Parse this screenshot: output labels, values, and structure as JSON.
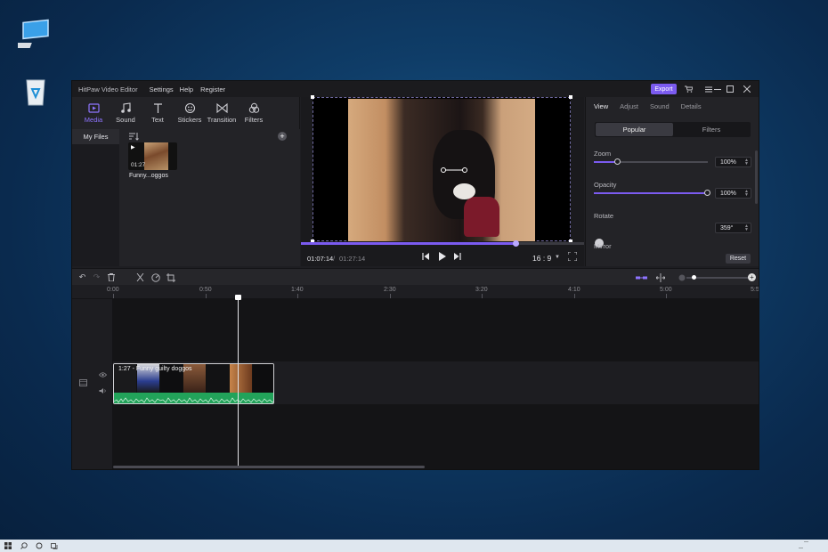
{
  "window": {
    "app_title": "HitPaw Video Editor",
    "menu": [
      "Settings",
      "Help",
      "Register"
    ],
    "export_label": "Export"
  },
  "tools": [
    {
      "label": "Media",
      "icon": "media-icon",
      "active": true
    },
    {
      "label": "Sound",
      "icon": "music-note-icon",
      "active": false
    },
    {
      "label": "Text",
      "icon": "text-icon",
      "active": false
    },
    {
      "label": "Stickers",
      "icon": "smiley-icon",
      "active": false
    },
    {
      "label": "Transition",
      "icon": "bowtie-icon",
      "active": false
    },
    {
      "label": "Filters",
      "icon": "circles-icon",
      "active": false
    }
  ],
  "sidebar": {
    "my_files": "My Files"
  },
  "media": [
    {
      "name": "Funny...oggos",
      "duration": "01:27"
    }
  ],
  "preview": {
    "current_time": "01:07:14",
    "separator": "/",
    "total_time": "01:27:14",
    "aspect_ratio": "16 : 9",
    "progress_fraction": 0.76
  },
  "properties": {
    "tabs": [
      "View",
      "Adjust",
      "Sound",
      "Details"
    ],
    "active_tab": "View",
    "segments": [
      "Popular",
      "Filters"
    ],
    "zoom": {
      "label": "Zoom",
      "value": "100%",
      "fraction": 0.2
    },
    "opacity": {
      "label": "Opacity",
      "value": "100%",
      "fraction": 1.0
    },
    "rotate": {
      "label": "Rotate",
      "value": "359°"
    },
    "mirror_label": "Mirror",
    "reset_label": "Reset"
  },
  "timeline": {
    "ruler": [
      "0:00",
      "0:50",
      "1:40",
      "2:30",
      "3:20",
      "4:10",
      "5:00",
      "5:5"
    ],
    "clip_label": "1:27 - Funny guilty doggos"
  },
  "colors": {
    "accent": "#7b5bf0",
    "audio_wave": "#22a35a",
    "taskbar": "#dfe7ef"
  }
}
